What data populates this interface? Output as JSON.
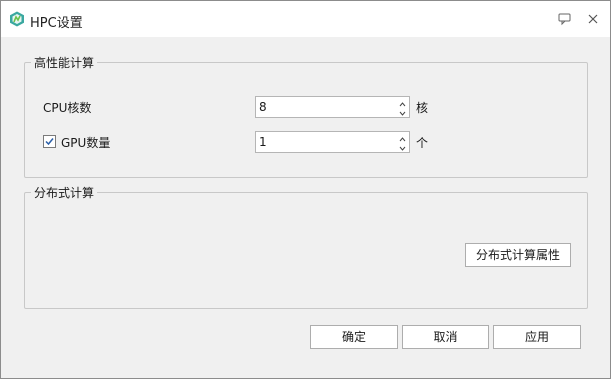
{
  "window": {
    "title": "HPC设置",
    "icons": {
      "app": "app-logo-icon",
      "help": "speech-bubble-icon",
      "close": "close-icon"
    }
  },
  "hpc_group": {
    "title": "高性能计算",
    "cpu": {
      "label": "CPU核数",
      "value": "8",
      "unit": "核"
    },
    "gpu": {
      "label": "GPU数量",
      "checked": true,
      "value": "1",
      "unit": "个"
    }
  },
  "distributed_group": {
    "title": "分布式计算",
    "properties_button": "分布式计算属性"
  },
  "footer": {
    "ok": "确定",
    "cancel": "取消",
    "apply": "应用"
  },
  "colors": {
    "app_icon_primary": "#3aa8a0",
    "app_icon_secondary": "#6cc24a"
  }
}
